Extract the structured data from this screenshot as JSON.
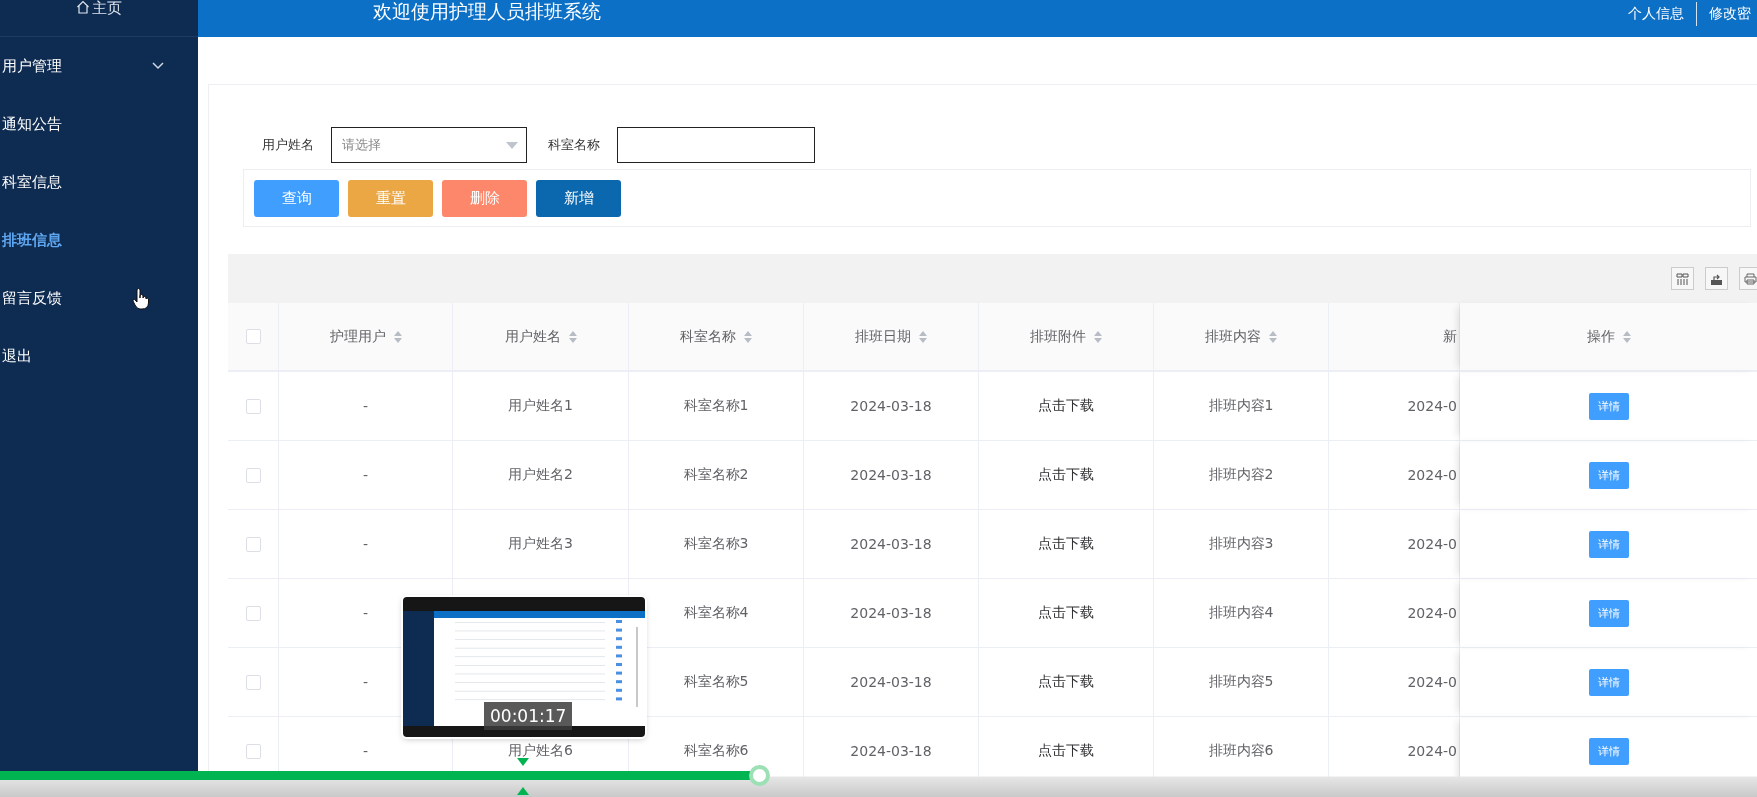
{
  "sidebar": {
    "home": "主页",
    "items": [
      {
        "label": "用户管理",
        "kind": "submenu",
        "selected": false
      },
      {
        "label": "通知公告",
        "kind": "link",
        "selected": false
      },
      {
        "label": "科室信息",
        "kind": "link",
        "selected": false
      },
      {
        "label": "排班信息",
        "kind": "link",
        "selected": true
      },
      {
        "label": "留言反馈",
        "kind": "link",
        "selected": false
      },
      {
        "label": "退出",
        "kind": "link",
        "selected": false
      }
    ]
  },
  "header": {
    "title": "欢迎使用护理人员排班系统",
    "links": [
      "个人信息",
      "修改密"
    ]
  },
  "search": {
    "fields": [
      {
        "label": "用户姓名",
        "kind": "select",
        "placeholder": "请选择"
      },
      {
        "label": "科室名称",
        "kind": "text"
      }
    ]
  },
  "buttons": [
    {
      "label": "查询",
      "color": "#409eff"
    },
    {
      "label": "重置",
      "color": "#eba743"
    },
    {
      "label": "删除",
      "color": "#fd876a"
    },
    {
      "label": "新增",
      "color": "#0b67ae"
    }
  ],
  "table": {
    "all_checked": false,
    "columns": [
      {
        "label": "护理用户",
        "sortable": true
      },
      {
        "label": "用户姓名",
        "sortable": true
      },
      {
        "label": "科室名称",
        "sortable": true
      },
      {
        "label": "排班日期",
        "sortable": true
      },
      {
        "label": "排班附件",
        "sortable": true
      },
      {
        "label": "排班内容",
        "sortable": true
      },
      {
        "label": "新",
        "sortable": false
      },
      {
        "label": "操作",
        "sortable": true
      }
    ],
    "rows": [
      {
        "checked": false,
        "cells": [
          "-",
          "用户姓名1",
          "科室名称1",
          "2024-03-18",
          "点击下载",
          "排班内容1",
          "2024-0"
        ],
        "action": "详情"
      },
      {
        "checked": false,
        "cells": [
          "-",
          "用户姓名2",
          "科室名称2",
          "2024-03-18",
          "点击下载",
          "排班内容2",
          "2024-0"
        ],
        "action": "详情"
      },
      {
        "checked": false,
        "cells": [
          "-",
          "用户姓名3",
          "科室名称3",
          "2024-03-18",
          "点击下载",
          "排班内容3",
          "2024-0"
        ],
        "action": "详情"
      },
      {
        "checked": false,
        "cells": [
          "-",
          null,
          "科室名称4",
          "2024-03-18",
          "点击下载",
          "排班内容4",
          "2024-0"
        ],
        "action": "详情"
      },
      {
        "checked": false,
        "cells": [
          "-",
          null,
          "科室名称5",
          "2024-03-18",
          "点击下载",
          "排班内容5",
          "2024-0"
        ],
        "action": "详情"
      },
      {
        "checked": false,
        "cells": [
          "-",
          "用户姓名6",
          "科室名称6",
          "2024-03-18",
          "点击下载",
          "排班内容6",
          "2024-0"
        ],
        "action": "详情"
      }
    ]
  },
  "video_player": {
    "level": 0.432,
    "preview_time": "00:01:17"
  }
}
